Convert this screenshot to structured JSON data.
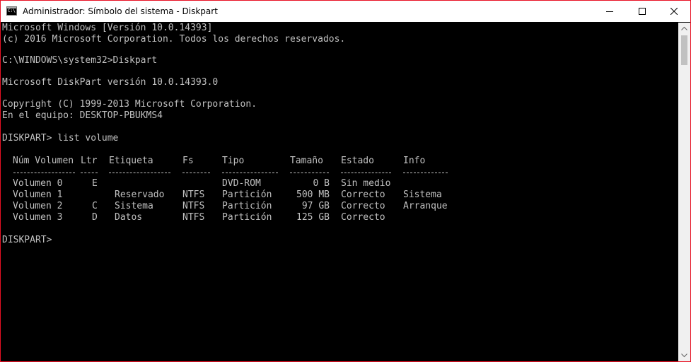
{
  "window": {
    "title": "Administrador: Símbolo del sistema - Diskpart",
    "icon_text": "C:\\",
    "icon": "cmd-icon",
    "controls": [
      "minimize-icon",
      "maximize-icon",
      "close-icon"
    ]
  },
  "colors": {
    "console_bg": "#000000",
    "console_text": "#c0c0c0",
    "window_border": "#e81123",
    "titlebar_bg": "#ffffff"
  },
  "console": {
    "header_lines": [
      "Microsoft Windows [Versión 10.0.14393]",
      "(c) 2016 Microsoft Corporation. Todos los derechos reservados.",
      "C:\\WINDOWS\\system32>Diskpart",
      "Microsoft DiskPart versión 10.0.14393.0",
      "Copyright (C) 1999-2013 Microsoft Corporation.",
      "En el equipo: DESKTOP-PBUKMS4",
      "DISKPART> list volume"
    ],
    "volume_table": {
      "columns": [
        "Núm Volumen",
        "Ltr",
        "Etiqueta",
        "Fs",
        "Tipo",
        "Tamaño",
        "Estado",
        "Info"
      ],
      "rows": [
        [
          "Volumen 0",
          "E",
          "",
          "",
          "DVD-ROM",
          "0 B",
          "Sin medio",
          ""
        ],
        [
          "Volumen 1",
          "",
          "Reservado",
          "NTFS",
          "Partición",
          "500 MB",
          "Correcto",
          "Sistema"
        ],
        [
          "Volumen 2",
          "C",
          "Sistema",
          "NTFS",
          "Partición",
          "97 GB",
          "Correcto",
          "Arranque"
        ],
        [
          "Volumen 3",
          "D",
          "Datos",
          "NTFS",
          "Partición",
          "125 GB",
          "Correcto",
          ""
        ]
      ]
    },
    "prompt": "DISKPART>"
  }
}
